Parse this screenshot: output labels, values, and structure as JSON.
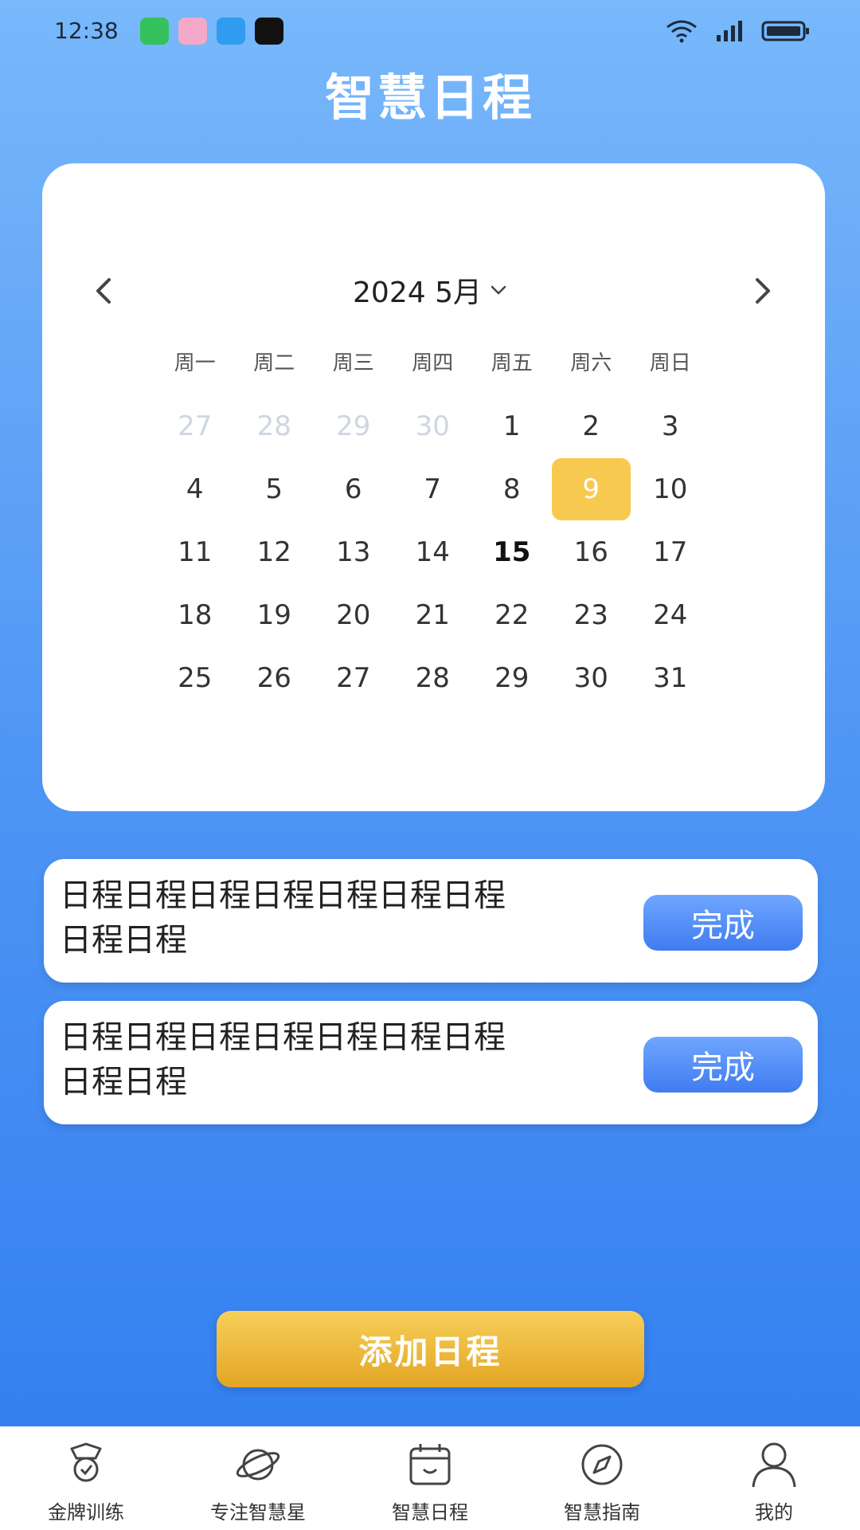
{
  "status_bar": {
    "time": "12:38",
    "apps": [
      {
        "icon": "app-green-icon",
        "color": "#35c15b"
      },
      {
        "icon": "app-pink-icon",
        "color": "#ef8db5"
      },
      {
        "icon": "app-blue-icon",
        "color": "#2f9cf0"
      },
      {
        "icon": "tiktok-icon",
        "color": "#111111"
      }
    ],
    "icons": [
      "wifi-icon",
      "signal-icon",
      "battery-icon"
    ]
  },
  "header": {
    "title": "智慧日程"
  },
  "calendar": {
    "month_label": "2024 5月",
    "weekdays": [
      "周一",
      "周二",
      "周三",
      "周四",
      "周五",
      "周六",
      "周日"
    ],
    "days": [
      {
        "label": "27",
        "muted": true
      },
      {
        "label": "28",
        "muted": true
      },
      {
        "label": "29",
        "muted": true
      },
      {
        "label": "30",
        "muted": true
      },
      {
        "label": "1"
      },
      {
        "label": "2"
      },
      {
        "label": "3"
      },
      {
        "label": "4"
      },
      {
        "label": "5"
      },
      {
        "label": "6"
      },
      {
        "label": "7"
      },
      {
        "label": "8"
      },
      {
        "label": "9",
        "selected": true
      },
      {
        "label": "10"
      },
      {
        "label": "11"
      },
      {
        "label": "12"
      },
      {
        "label": "13"
      },
      {
        "label": "14"
      },
      {
        "label": "15",
        "bold": true
      },
      {
        "label": "16"
      },
      {
        "label": "17"
      },
      {
        "label": "18"
      },
      {
        "label": "19"
      },
      {
        "label": "20"
      },
      {
        "label": "21"
      },
      {
        "label": "22"
      },
      {
        "label": "23"
      },
      {
        "label": "24"
      },
      {
        "label": "25"
      },
      {
        "label": "26"
      },
      {
        "label": "27"
      },
      {
        "label": "28"
      },
      {
        "label": "29"
      },
      {
        "label": "30"
      },
      {
        "label": "31"
      }
    ],
    "selected_color": "#f8c94f"
  },
  "schedules": [
    {
      "text": "日程日程日程日程日程日程日程日程日程",
      "button": "完成"
    },
    {
      "text": "日程日程日程日程日程日程日程日程日程",
      "button": "完成"
    }
  ],
  "add_button": {
    "label": "添加日程",
    "color": "#e8ad2c"
  },
  "tabs": [
    {
      "label": "金牌训练",
      "icon": "medal-icon"
    },
    {
      "label": "专注智慧星",
      "icon": "planet-icon"
    },
    {
      "label": "智慧日程",
      "icon": "calendar-icon"
    },
    {
      "label": "智慧指南",
      "icon": "compass-icon"
    },
    {
      "label": "我的",
      "icon": "user-icon"
    }
  ],
  "colors": {
    "accent": "#3f7cf0",
    "background_top": "#78b8fb",
    "background_bottom": "#2f7df0"
  }
}
